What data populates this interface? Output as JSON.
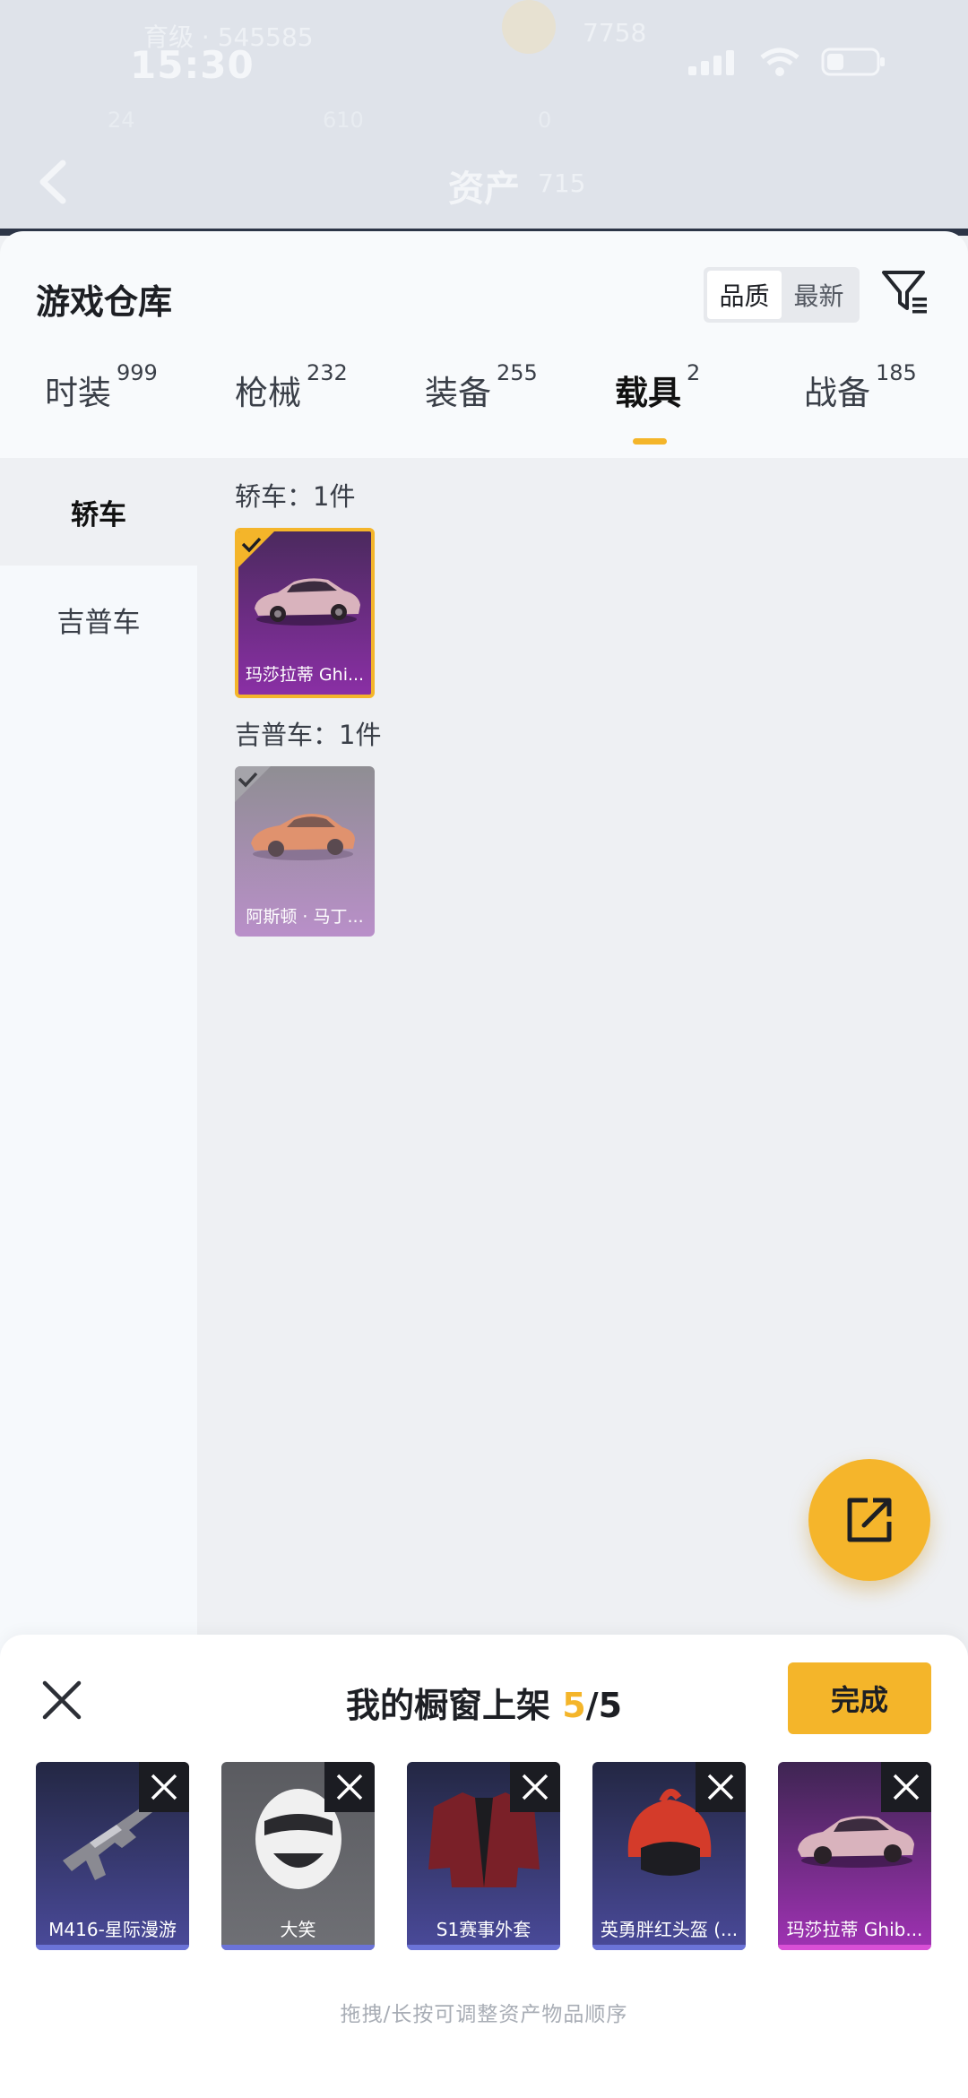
{
  "status_bar": {
    "time": "15:30",
    "top_left_text": "育级 · 545585",
    "top_right_text": "7758"
  },
  "background_header": {
    "title": "资产",
    "title_suffix": "715",
    "stats": [
      "24",
      "610",
      "0"
    ]
  },
  "sheet": {
    "title": "游戏仓库",
    "sort": {
      "options": [
        "品质",
        "最新"
      ],
      "active": "品质"
    },
    "tabs": [
      {
        "label": "时装",
        "count": "999"
      },
      {
        "label": "枪械",
        "count": "232"
      },
      {
        "label": "装备",
        "count": "255"
      },
      {
        "label": "载具",
        "count": "2",
        "active": true
      },
      {
        "label": "战备",
        "count": "185"
      }
    ],
    "categories": [
      {
        "label": "轿车",
        "active": true
      },
      {
        "label": "吉普车"
      }
    ],
    "groups": [
      {
        "label": "轿车：1件",
        "items": [
          {
            "name": "玛莎拉蒂 Ghi...",
            "selected": true
          }
        ]
      },
      {
        "label": "吉普车：1件",
        "items": [
          {
            "name": "阿斯顿 · 马丁...",
            "selected": false
          }
        ]
      }
    ]
  },
  "showcase": {
    "title_prefix": "我的橱窗上架",
    "count_current": "5",
    "count_total": "/5",
    "done_label": "完成",
    "slots": [
      {
        "name": "M416-星际漫游",
        "icon": "rifle-icon"
      },
      {
        "name": "大笑",
        "icon": "laughing-mask-icon"
      },
      {
        "name": "S1赛事外套",
        "icon": "jacket-icon"
      },
      {
        "name": "英勇胖红头盔 (...",
        "icon": "helmet-icon"
      },
      {
        "name": "玛莎拉蒂 Ghib...",
        "icon": "car-icon"
      }
    ],
    "hint": "拖拽/长按可调整资产物品顺序"
  },
  "colors": {
    "accent": "#f4b52a",
    "purple_card": "#6a2a8c",
    "blue_card": "#3b3f8c",
    "gray_card": "#5f6066"
  }
}
